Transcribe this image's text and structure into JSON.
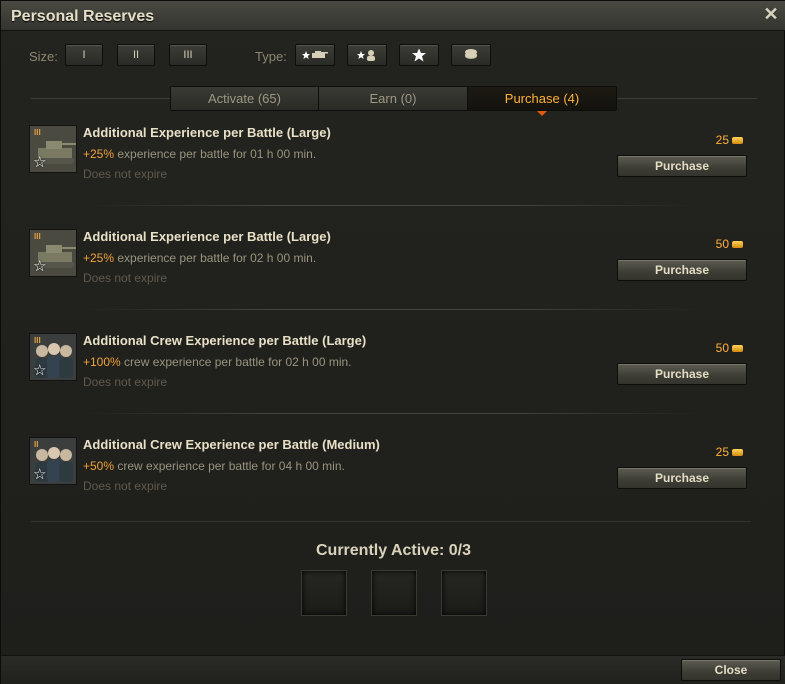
{
  "window": {
    "title": "Personal Reserves",
    "close_glyph": "✕"
  },
  "filters": {
    "size_label": "Size:",
    "size_buttons": [
      "I",
      "II",
      "III"
    ],
    "type_label": "Type:",
    "type_icons": [
      "tank-star-icon",
      "crew-star-icon",
      "star-icon",
      "coins-icon"
    ]
  },
  "tabs": [
    {
      "label": "Activate (65)",
      "active": false
    },
    {
      "label": "Earn (0)",
      "active": false
    },
    {
      "label": "Purchase (4)",
      "active": true
    }
  ],
  "items": [
    {
      "title": "Additional Experience per Battle (Large)",
      "pct": "+25%",
      "desc": " experience per battle for 01 h 00 min.",
      "expire": "Does not expire",
      "price": "25",
      "button": "Purchase",
      "level": "III",
      "icon": "tank-icon"
    },
    {
      "title": "Additional Experience per Battle (Large)",
      "pct": "+25%",
      "desc": " experience per battle for 02 h 00 min.",
      "expire": "Does not expire",
      "price": "50",
      "button": "Purchase",
      "level": "III",
      "icon": "tank-icon"
    },
    {
      "title": "Additional Crew Experience per Battle (Large)",
      "pct": "+100%",
      "desc": " crew experience per battle for 02 h 00 min.",
      "expire": "Does not expire",
      "price": "50",
      "button": "Purchase",
      "level": "III",
      "icon": "crew-icon"
    },
    {
      "title": "Additional Crew Experience per Battle (Medium)",
      "pct": "+50%",
      "desc": " crew experience per battle for 04 h 00 min.",
      "expire": "Does not expire",
      "price": "25",
      "button": "Purchase",
      "level": "II",
      "icon": "crew-icon"
    }
  ],
  "active": {
    "title": "Currently Active: 0/3",
    "slots": 3
  },
  "footer": {
    "close_label": "Close"
  },
  "colors": {
    "accent": "#ffb23b",
    "active_tab_marker": "#e05a10",
    "percent": "#f0a33a"
  }
}
